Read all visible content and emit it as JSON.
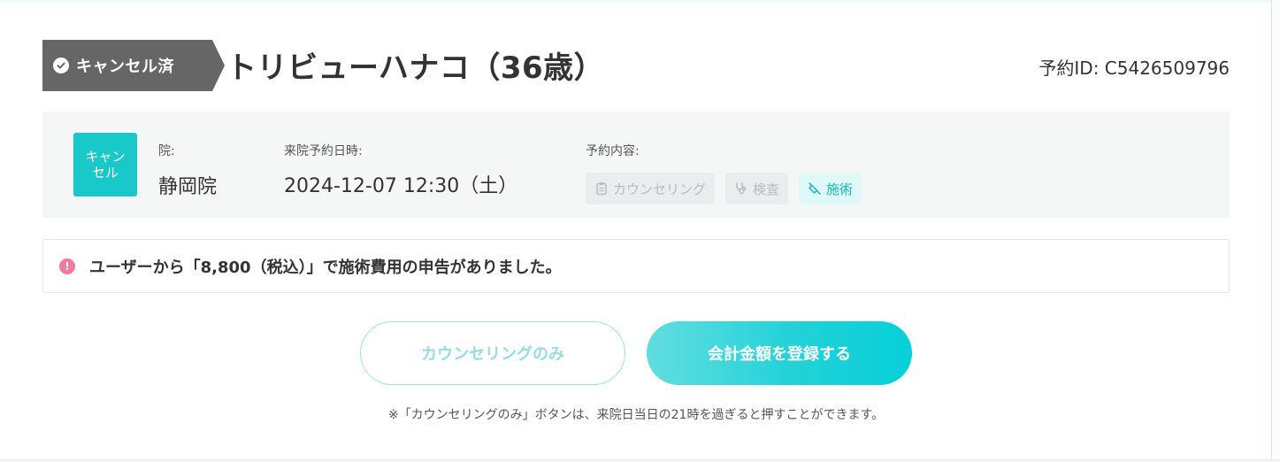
{
  "header": {
    "status_label": "キャンセル済",
    "patient_name": "トリビューハナコ（36歳）",
    "reservation_id": "予約ID: C5426509796"
  },
  "info": {
    "badge_line1": "キャン",
    "badge_line2": "セル",
    "clinic_label": "院:",
    "clinic_value": "静岡院",
    "datetime_label": "来院予約日時:",
    "datetime_value": "2024-12-07 12:30（土）",
    "content_label": "予約内容:",
    "chips": [
      {
        "label": "カウンセリング",
        "icon": "clipboard-icon",
        "state": "inactive"
      },
      {
        "label": "検査",
        "icon": "stethoscope-icon",
        "state": "inactive"
      },
      {
        "label": "施術",
        "icon": "syringe-icon",
        "state": "active"
      }
    ]
  },
  "notice": {
    "icon": "alert-icon",
    "icon_glyph": "!",
    "text": "ユーザーから「8,800（税込）」で施術費用の申告がありました。"
  },
  "actions": {
    "counseling_only_label": "カウンセリングのみ",
    "register_amount_label": "会計金額を登録する",
    "footnote": "※「カウンセリングのみ」ボタンは、来院日当日の21時を過ぎると押すことができます。"
  },
  "colors": {
    "accent": "#19c9c9",
    "status_tag": "#666666",
    "alert": "#f07aa0",
    "panel_bg": "#f5f7f7"
  }
}
